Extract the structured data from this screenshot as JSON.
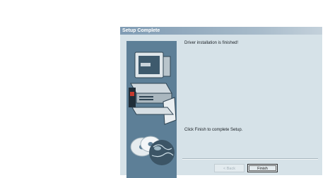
{
  "window": {
    "title": "Setup Complete"
  },
  "content": {
    "message_top": "Driver installation is finished!",
    "message_bottom": "Click Finish to complete Setup."
  },
  "buttons": {
    "back_label": "< Back",
    "finish_label": "Finish"
  },
  "colors": {
    "dialog_bg": "#d6e2e8",
    "art_bg": "#5d7f97",
    "titlebar": "#7f9bb3"
  }
}
